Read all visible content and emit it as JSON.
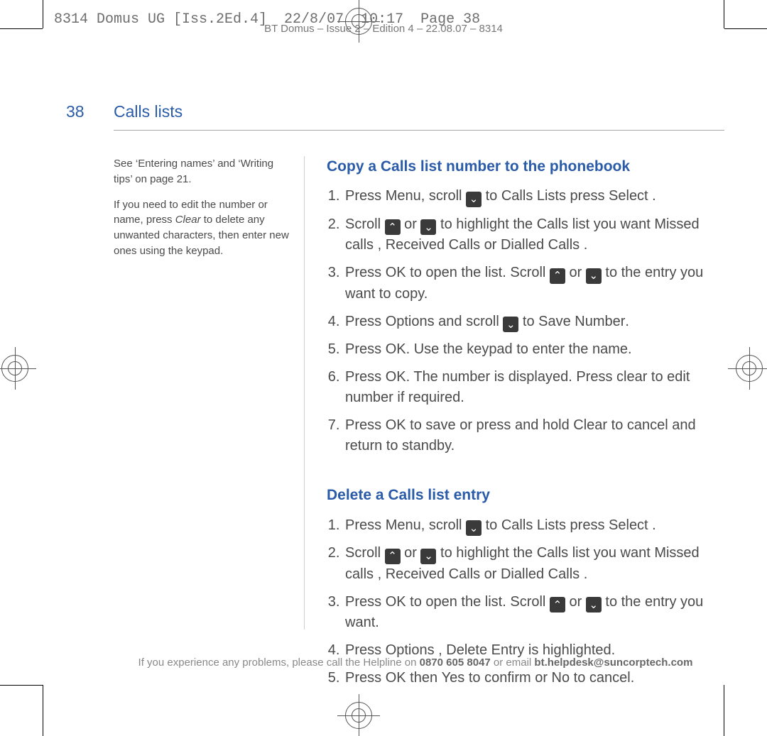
{
  "slug": "8314 Domus UG [Iss.2Ed.4]  22/8/07  10:17  Page 38",
  "doc_header": "BT Domus – Issue 2 – Edition 4 – 22.08.07 – 8314",
  "page_number": "38",
  "section_title": "Calls lists",
  "sidebar": {
    "p1_a": "See ‘Entering names’ and ‘Writing tips’ on page ",
    "p1_page": "21",
    "p1_c": ".",
    "p2_a": "If you need to edit the number or name, press ",
    "p2_clear": "Clear",
    "p2_b": " to delete any unwanted characters, then enter new ones using the keypad."
  },
  "copy": {
    "heading": "Copy a Calls list number to the phonebook",
    "s1_a": "Press ",
    "s1_menu": "Menu",
    "s1_b": ", scroll ",
    "s1_c": " to ",
    "s1_calls": "Calls Lists",
    "s1_d": "    press ",
    "s1_select": "Select",
    "s1_e": " .",
    "s2_a": "Scroll ",
    "s2_or": " or ",
    "s2_b": " to highlight the Calls list you want ",
    "s2_missed": "Missed calls",
    "s2_c": " , ",
    "s2_received": "Received Calls",
    "s2_d": "   or ",
    "s2_dialled": "Dialled Calls",
    "s2_e": "   .",
    "s3_a": "Press ",
    "s3_ok": "OK",
    "s3_b": " to open the list. Scroll ",
    "s3_or": " or ",
    "s3_c": " to the entry you want to copy.",
    "s4_a": "Press ",
    "s4_options": "Options",
    "s4_b": "  and scroll ",
    "s4_c": " to ",
    "s4_save": "Save Number",
    "s4_d": ".",
    "s5_a": "Press ",
    "s5_ok": "OK",
    "s5_b": ". Use the keypad to enter the name.",
    "s6_a": "Press ",
    "s6_ok": "OK",
    "s6_b": ". The number is displayed. Press clear to edit number if required.",
    "s7_a": "Press ",
    "s7_ok": "OK",
    "s7_b": " to save or press and hold ",
    "s7_clear": "Clear",
    "s7_c": " to cancel and return to standby."
  },
  "del": {
    "heading": "Delete a Calls list entry",
    "s1_a": "Press ",
    "s1_menu": "Menu",
    "s1_b": ", scroll ",
    "s1_c": " to ",
    "s1_calls": "Calls Lists",
    "s1_d": "    press ",
    "s1_select": "Select",
    "s1_e": " .",
    "s2_a": "Scroll ",
    "s2_or": " or ",
    "s2_b": " to highlight the Calls list you want ",
    "s2_missed": "Missed calls",
    "s2_c": " , ",
    "s2_received": "Received  Calls",
    "s2_d": " or ",
    "s2_dialled": "Dialled  Calls",
    "s2_e": " .",
    "s3_a": "Press ",
    "s3_ok": "OK",
    "s3_b": " to open the list. Scroll ",
    "s3_or": " or ",
    "s3_c": " to the entry you want.",
    "s4_a": "Press ",
    "s4_options": "Options",
    "s4_b": " , ",
    "s4_del": "Delete  Entry",
    "s4_c": "  is highlighted.",
    "s5_a": "Press ",
    "s5_ok": "OK",
    "s5_b": " then ",
    "s5_yes": "Yes",
    "s5_c": " to confirm or ",
    "s5_no": "No",
    "s5_d": " to cancel."
  },
  "footer": {
    "a": "If you experience any problems, please call the Helpline on ",
    "phone": "0870 605 8047",
    "b": " or email ",
    "email": "bt.helpdesk@suncorptech.com"
  }
}
